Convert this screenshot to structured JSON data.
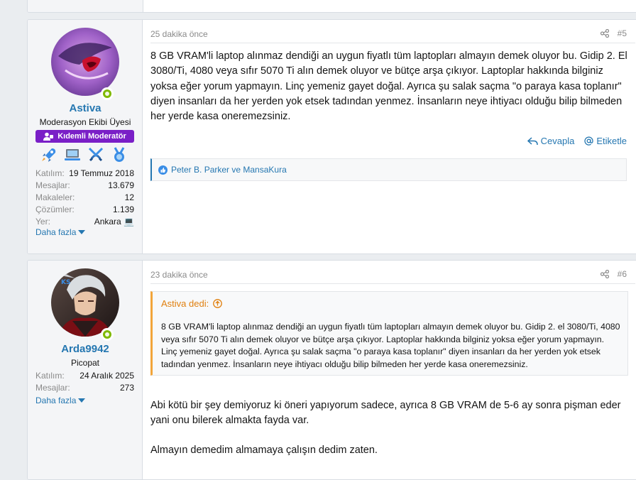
{
  "posts": [
    {
      "username": "Astiva",
      "user_title": "Moderasyon Ekibi Üyesi",
      "banner": "Kıdemli Moderatör",
      "stats": [
        {
          "label": "Katılım:",
          "value": "19 Temmuz 2018"
        },
        {
          "label": "Mesajlar:",
          "value": "13.679"
        },
        {
          "label": "Makaleler:",
          "value": "12"
        },
        {
          "label": "Çözümler:",
          "value": "1.139"
        },
        {
          "label": "Yer:",
          "value": "Ankara 💻"
        }
      ],
      "more": "Daha fazla",
      "time": "25 dakika önce",
      "number": "#5",
      "body": "8 GB VRAM'li laptop alınmaz dendiği an uygun fiyatlı tüm laptopları almayın demek oluyor bu. Gidip 2. El 3080/Ti, 4080 veya sıfır 5070 Ti alın demek oluyor ve bütçe arşa çıkıyor. Laptoplar hakkında bilginiz yoksa eğer yorum yapmayın. Linç yemeniz gayet doğal. Ayrıca şu salak saçma \"o paraya kasa toplanır\" diyen insanları da her yerden yok etsek tadından yenmez. İnsanların neye ihtiyacı olduğu bilip bilmeden her yerde kasa oneremezsiniz.",
      "reply_label": "Cevapla",
      "mention_label": "Etiketle",
      "reactions": "Peter B. Parker ve MansaKura"
    },
    {
      "username": "Arda9942",
      "user_title": "Picopat",
      "stats": [
        {
          "label": "Katılım:",
          "value": "24 Aralık 2025"
        },
        {
          "label": "Mesajlar:",
          "value": "273"
        }
      ],
      "more": "Daha fazla",
      "time": "23 dakika önce",
      "number": "#6",
      "quote_author": "Astiva dedi:",
      "quote_body": "8 GB VRAM'li laptop alınmaz dendiği an uygun fiyatlı tüm laptopları almayın demek oluyor bu. Gidip 2. el 3080/Ti, 4080 veya sıfır 5070 Ti alın demek oluyor ve bütçe arşa çıkıyor. Laptoplar hakkında bilginiz yoksa eğer yorum yapmayın. Linç yemeniz gayet doğal. Ayrıca şu salak saçma \"o paraya kasa toplanır\" diyen insanları da her yerden yok etsek tadından yenmez. İnsanların neye ihtiyacı olduğu bilip bilmeden her yerde kasa oneremezsiniz.",
      "body_p1": "Abi kötü bir şey demiyoruz ki öneri yapıyorum sadece, ayrıca 8 GB VRAM de 5-6 ay sonra pişman eder yani onu bilerek almakta fayda var.",
      "body_p2": "Almayın demedim almamaya çalışın dedim zaten."
    }
  ],
  "colors": {
    "link": "#2577b1",
    "banner": "#7a1fc7",
    "online": "#7fb900",
    "quote_accent": "#f2a53a"
  },
  "icons": [
    "share-icon",
    "reply-icon",
    "at-icon",
    "like-icon",
    "caret-down-icon",
    "online-icon",
    "arrow-up-circle-icon",
    "trophy-rocket-icon",
    "trophy-laptop-icon",
    "trophy-swords-icon",
    "trophy-medal-icon",
    "user-badge-icon"
  ]
}
